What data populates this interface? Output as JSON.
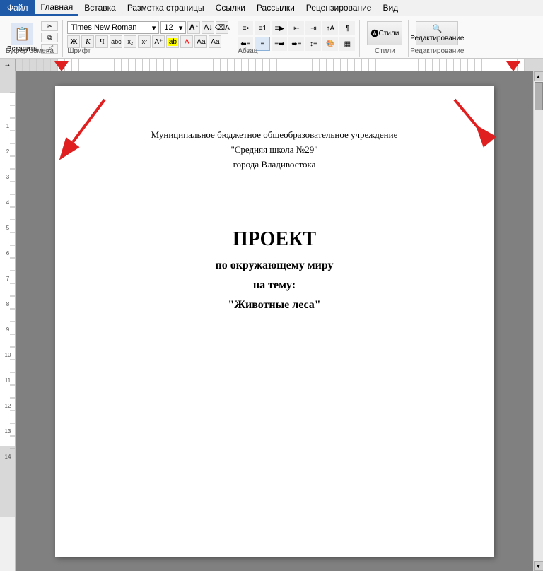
{
  "menubar": {
    "file": "Файл",
    "home": "Главная",
    "insert": "Вставка",
    "page_layout": "Разметка страницы",
    "links": "Ссылки",
    "mailings": "Рассылки",
    "review": "Рецензирование",
    "view": "Вид"
  },
  "ribbon": {
    "clipboard_group": "Буфер обмена",
    "clipboard_expand": "↘",
    "paste_label": "Вставить",
    "cut_label": "✂",
    "copy_label": "⧉",
    "format_copy_label": "🖌",
    "font_group": "Шрифт",
    "font_name": "Times New Roman",
    "font_size": "12",
    "font_expand": "↘",
    "bold": "Ж",
    "italic": "К",
    "underline": "Ч",
    "strikethrough": "abc",
    "subscript": "x₂",
    "superscript": "x²",
    "font_color_label": "А",
    "font_highlight": "ab",
    "font_color": "А",
    "font_aa1": "Аа",
    "font_aa2": "Аа",
    "font_grow": "A",
    "font_shrink": "A",
    "font_clear": "A",
    "para_group": "Абзац",
    "para_expand": "↘",
    "list_bullets": "≡",
    "list_numbers": "≡",
    "list_multi": "≡",
    "decrease_indent": "⇤",
    "increase_indent": "⇥",
    "sort": "↕A",
    "show_marks": "¶",
    "align_left": "≡",
    "align_center": "≡",
    "align_right": "≡",
    "justify": "≡",
    "line_spacing": "≡",
    "shading": "▣",
    "borders": "▦",
    "styles_group": "Стили",
    "styles_label": "Стили",
    "editing_group": "Редактирование",
    "editing_label": "Редактирование"
  },
  "document": {
    "header_line1": "Муниципальное бюджетное общеобразовательное учреждение",
    "header_line2": "\"Средняя школа №29\"",
    "header_line3": "города Владивостока",
    "title": "ПРОЕКТ",
    "subtitle1": "по окружающему миру",
    "subtitle2": "на тему:",
    "subtitle3": "\"Животные леса\""
  },
  "arrows": {
    "left_arrow_color": "#e02020",
    "right_arrow_color": "#e02020"
  }
}
